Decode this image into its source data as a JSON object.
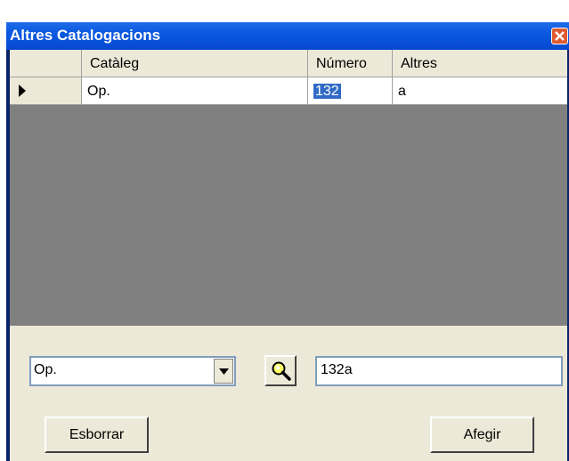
{
  "window": {
    "title": "Altres Catalogacions"
  },
  "grid": {
    "columns": [
      "",
      "Catàleg",
      "Número",
      "Altres"
    ],
    "rows": [
      {
        "cataleg": "Op.",
        "numero": "132",
        "altres": "a"
      }
    ]
  },
  "form": {
    "catalog_value": "Op.",
    "text_value": "132a",
    "delete_label": "Esborrar",
    "add_label": "Afegir"
  },
  "icons": {
    "close": "close-icon",
    "row_indicator": "triangle-right-icon",
    "dropdown": "chevron-down-icon",
    "search": "magnifier-icon"
  },
  "colors": {
    "title_bar": "#0a58e0",
    "selection": "#316ac5",
    "grid_empty": "#808080",
    "dialog_bg": "#ece9d8"
  }
}
